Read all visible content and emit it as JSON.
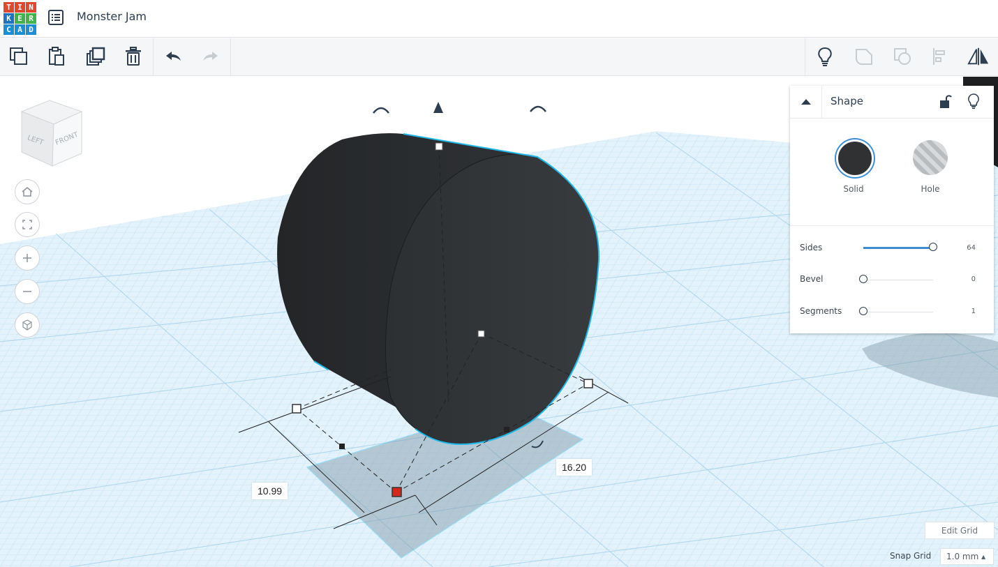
{
  "app": {
    "logo_letters": [
      "T",
      "I",
      "N",
      "K",
      "E",
      "R",
      "C",
      "A",
      "D"
    ],
    "project_title": "Monster Jam"
  },
  "toolbar": {
    "buttons": [
      "copy-icon",
      "paste-icon",
      "duplicate-icon",
      "trash-icon",
      "undo-icon",
      "redo-icon"
    ],
    "right_buttons": [
      "lightbulb-icon",
      "group-icon",
      "ungroup-icon",
      "align-icon",
      "mirror-icon"
    ]
  },
  "view_cube": {
    "left": "LEFT",
    "front": "FRONT"
  },
  "nav": [
    "home-icon",
    "fit-view-icon",
    "zoom-in-icon",
    "zoom-out-icon",
    "ortho-view-icon"
  ],
  "shape_panel": {
    "title": "Shape",
    "solid_label": "Solid",
    "hole_label": "Hole",
    "solid_color": "#2f3133",
    "properties": [
      {
        "label": "Sides",
        "value": "64",
        "fraction": 1.0
      },
      {
        "label": "Bevel",
        "value": "0",
        "fraction": 0.0
      },
      {
        "label": "Segments",
        "value": "1",
        "fraction": 0.0
      }
    ]
  },
  "dimensions": {
    "width": "10.99",
    "length": "16.20"
  },
  "grid": {
    "edit_label": "Edit Grid",
    "snap_label": "Snap Grid",
    "snap_value": "1.0 mm ▴"
  },
  "colors": {
    "grid": "#cfe8f6",
    "accent": "#3b8dd6",
    "selection": "#1fb7e8"
  }
}
